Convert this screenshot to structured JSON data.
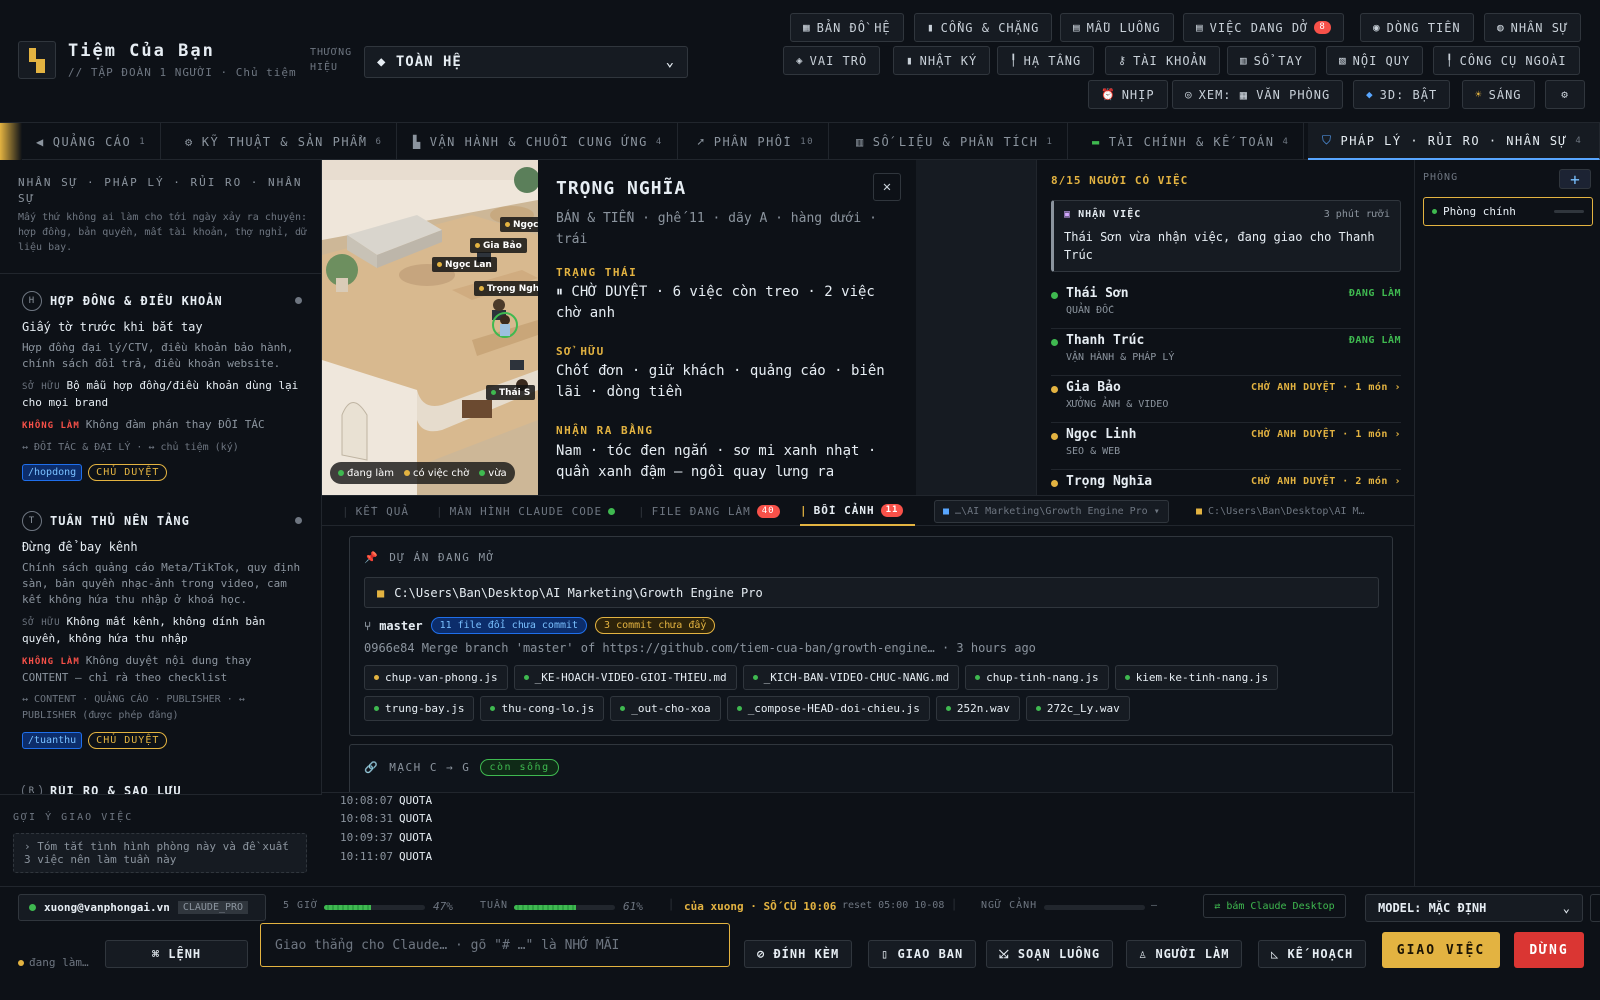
{
  "brand": {
    "title": "Tiệm Của Bạn",
    "subtitle": "// TẬP ĐOÀN 1 NGƯỜI · Chủ tiệm",
    "label": "THƯƠNG HIỆU",
    "selected": "◆ TOÀN HỆ"
  },
  "toolbar": {
    "row1": [
      {
        "icon": "▦",
        "label": "BẢN ĐỒ HỆ"
      },
      {
        "icon": "▮",
        "label": "CỔNG & CHẶNG"
      },
      {
        "icon": "▤",
        "label": "MẪU LUỒNG"
      },
      {
        "icon": "▤",
        "label": "VIỆC DANG DỞ",
        "badge": "8"
      },
      {
        "icon": "◉",
        "label": "DÒNG TIỀN"
      },
      {
        "icon": "◍",
        "label": "NHÂN SỰ"
      }
    ],
    "row2": [
      {
        "icon": "◈",
        "label": "VAI TRÒ"
      },
      {
        "icon": "▮",
        "label": "NHẬT KÝ"
      },
      {
        "icon": "╿",
        "label": "HẠ TẦNG"
      },
      {
        "icon": "⚷",
        "label": "TÀI KHOẢN"
      },
      {
        "icon": "▥",
        "label": "SỔ TAY"
      },
      {
        "icon": "▧",
        "label": "NỘI QUY"
      },
      {
        "icon": "╿",
        "label": "CÔNG CỤ NGOÀI"
      }
    ],
    "row3": [
      {
        "icon": "⏰",
        "label": "NHỊP"
      },
      {
        "icon": "◎",
        "label": "XEM: ▦ VĂN PHÒNG"
      },
      {
        "icon": "◆",
        "label": "3D: BẬT"
      },
      {
        "icon": "☀",
        "label": "SÁNG"
      },
      {
        "icon": "⚙",
        "label": ""
      }
    ]
  },
  "tabs": [
    {
      "icon": "◀",
      "label": "QUẢNG CÁO",
      "count": "1"
    },
    {
      "icon": "⚙",
      "label": "KỸ THUẬT & SẢN PHẨM",
      "count": "6"
    },
    {
      "icon": "▙",
      "label": "VẬN HÀNH & CHUỖI CUNG ỨNG",
      "count": "4"
    },
    {
      "icon": "➚",
      "label": "PHÂN PHỐI",
      "count": "10"
    },
    {
      "icon": "▥",
      "label": "SỐ LIỆU & PHÂN TÍCH",
      "count": "1"
    },
    {
      "icon": "▬",
      "label": "TÀI CHÍNH & KẾ TOÁN",
      "count": "4"
    },
    {
      "icon": "⛉",
      "label": "PHÁP LÝ · RỦI RO · NHÂN SỰ",
      "count": "4"
    }
  ],
  "left": {
    "heading": "NHÂN SỰ · PHÁP LÝ · RỦI RO · NHÂN SỰ",
    "desc": "Mấy thứ không ai làm cho tới ngày xảy ra chuyện: hợp đồng, bản quyền, mất tài khoản, thợ nghỉ, dữ liệu bay.",
    "cards": [
      {
        "initial": "H",
        "title": "HỢP ĐỒNG & ĐIỀU KHOẢN",
        "sub": "Giấy tờ trước khi bắt tay",
        "desc": "Hợp đồng đại lý/CTV, điều khoản bảo hành, chính sách đổi trả, điều khoản website.",
        "own_label": "SỞ HỮU",
        "own": "Bộ mẫu hợp đồng/điều khoản dùng lại cho mọi brand",
        "no_label": "KHÔNG LÀM",
        "no": "Không đàm phán thay ĐỐI TÁC",
        "rel": "↔ ĐỐI TÁC & ĐẠI LÝ  ·  ↔ chủ tiệm (ký)",
        "tag": "/hopdong",
        "badge": "CHỦ DUYỆT"
      },
      {
        "initial": "T",
        "title": "TUÂN THỦ NỀN TẢNG",
        "sub": "Đừng để bay kênh",
        "desc": "Chính sách quảng cáo Meta/TikTok, quy định sàn, bản quyền nhạc-ảnh trong video, cam kết không hứa thu nhập ở khoá học.",
        "own_label": "SỞ HỮU",
        "own": "Không mất kênh, không dính bản quyền, không hứa thu nhập",
        "no_label": "KHÔNG LÀM",
        "no": "Không duyệt nội dung thay CONTENT — chỉ rà theo checklist",
        "rel": "↔ CONTENT · QUẢNG CÁO · PUBLISHER  ·  ↔ PUBLISHER (được phép đăng)",
        "tag": "/tuanthu",
        "badge": "CHỦ DUYỆT"
      },
      {
        "initial": "R",
        "title": "RỦI RO & SAO LƯU"
      }
    ]
  },
  "suggest": {
    "title": "GỢI Ý GIAO VIỆC",
    "text": "› Tóm tắt tình hình phòng này và đề xuất 3 việc nên làm tuần này"
  },
  "office": {
    "labels": [
      "Ngọc",
      "Gia Bảo",
      "Ngọc Lan",
      "Trọng Ngh",
      "Thái S"
    ],
    "legend": [
      "đang làm",
      "có việc chờ",
      "vừa"
    ]
  },
  "detail": {
    "name": "TRỌNG NGHĨA",
    "meta": "BÁN & TIỀN · ghế 11 · dãy A · hàng dưới · trái",
    "status_h": "TRẠNG THÁI",
    "status": "⏸ CHỜ DUYỆT · 6 việc còn treo · 2 việc chờ anh",
    "own_h": "SỞ HỮU",
    "own": "Chốt đơn · giữ khách · quảng cáo · biên lãi · dòng tiền",
    "recog_h": "NHẬN RA BẰNG",
    "recog": "Nam · tóc đen ngắn · sơ mi xanh nhạt · quần xanh đậm — ngồi quay lưng ra"
  },
  "people": {
    "header": "8/15 NGƯỜI CÓ VIỆC",
    "notice": {
      "label": "NHẬN VIỆC",
      "time": "3 phút rưỡi",
      "msg": "Thái Sơn vừa nhận việc, đang giao cho Thanh Trúc"
    },
    "list": [
      {
        "name": "Thái Sơn",
        "role": "QUẢN ĐỐC",
        "status": "ĐANG LÀM",
        "color": "#3fb950"
      },
      {
        "name": "Thanh Trúc",
        "role": "VẬN HÀNH & PHÁP LÝ",
        "status": "ĐANG LÀM",
        "color": "#3fb950"
      },
      {
        "name": "Gia Bảo",
        "role": "XƯỞNG ẢNH & VIDEO",
        "status": "CHỜ ANH DUYỆT · 1 món ›",
        "color": "#e3b341"
      },
      {
        "name": "Ngọc Linh",
        "role": "SEO & WEB",
        "status": "CHỜ ANH DUYỆT · 1 món ›",
        "color": "#e3b341"
      },
      {
        "name": "Trọng Nghĩa",
        "role": "",
        "status": "CHỜ ANH DUYỆT · 2 món ›",
        "color": "#e3b341"
      }
    ]
  },
  "rooms": {
    "title": "PHÒNG",
    "add": "+",
    "items": [
      "Phòng chính"
    ]
  },
  "subtabs": [
    {
      "label": "KẾT QUẢ"
    },
    {
      "label": "MÀN HÌNH CLAUDE CODE"
    },
    {
      "label": "FILE ĐANG LÀM",
      "badge": "40"
    },
    {
      "label": "BỐI CẢNH",
      "badge": "11"
    }
  ],
  "path_chips": [
    "…\\AI Marketing\\Growth Engine Pro ▾",
    "C:\\Users\\Ban\\Desktop\\AI M…"
  ],
  "project": {
    "title": "DỰ ÁN ĐANG MỞ",
    "path": "C:\\Users\\Ban\\Desktop\\AI Marketing\\Growth Engine Pro",
    "branch": "master",
    "uncommitted": "11 file đổi chưa commit",
    "unpushed": "3 commit chưa đẩy",
    "commit": "0966e84 Merge branch 'master' of https://github.com/tiem-cua-ban/growth-engine… · 3 hours ago",
    "files": [
      {
        "name": "chup-van-phong.js",
        "color": "#e3b341"
      },
      {
        "name": "_KE-HOACH-VIDEO-GIOI-THIEU.md",
        "color": "#3fb950"
      },
      {
        "name": "_KICH-BAN-VIDEO-CHUC-NANG.md",
        "color": "#3fb950"
      },
      {
        "name": "chup-tinh-nang.js",
        "color": "#3fb950"
      },
      {
        "name": "kiem-ke-tinh-nang.js",
        "color": "#3fb950"
      },
      {
        "name": "trung-bay.js",
        "color": "#3fb950"
      },
      {
        "name": "thu-cong-lo.js",
        "color": "#3fb950"
      },
      {
        "name": "_out-cho-xoa",
        "color": "#3fb950"
      },
      {
        "name": "_compose-HEAD-doi-chieu.js",
        "color": "#3fb950"
      },
      {
        "name": "252n.wav",
        "color": "#3fb950"
      },
      {
        "name": "272c_Ly.wav",
        "color": "#3fb950"
      }
    ]
  },
  "circuit": {
    "title": "MẠCH C → G",
    "status": "còn sống"
  },
  "log": [
    {
      "time": "10:08:07",
      "text": "QUOTA"
    },
    {
      "time": "10:08:31",
      "text": "QUOTA"
    },
    {
      "time": "10:09:37",
      "text": "QUOTA"
    },
    {
      "time": "10:11:07",
      "text": "QUOTA"
    }
  ],
  "status": {
    "account": "xuong@vanphongai.vn",
    "plan": "CLAUDE_PRO",
    "h5_label": "5 GIỜ",
    "h5_value": "47%",
    "h5_fraction": 0.47,
    "week_label": "TUẦN",
    "week_value": "61%",
    "week_fraction": 0.61,
    "shop": "của xuong · SỐ CŨ 10:06",
    "reset": "reset 05:00 10-08",
    "ctx_label": "NGỮ CẢNH",
    "ctx_value": "—",
    "claude_desktop": "⇄ bám Claude Desktop",
    "model": "MODEL: MẶC ĐỊNH"
  },
  "inputbar": {
    "working": "đang làm…",
    "cmd": "⌘ LỆNH",
    "placeholder": "Giao thẳng cho Claude… · gõ \"# …\" là NHỚ MÃI",
    "attach": "⊘ ĐÍNH KÈM",
    "brief": "▯ GIAO BAN",
    "flow": "⤩ SOẠN LUỒNG",
    "worker": "♙ NGƯỜI LÀM",
    "plan": "◺ KẾ HOẠCH",
    "go": "GIAO VIỆC",
    "stop": "DỪNG"
  }
}
